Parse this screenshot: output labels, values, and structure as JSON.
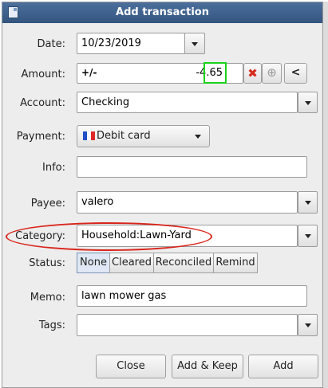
{
  "title": "Add transaction",
  "labels": {
    "date": "Date:",
    "amount": "Amount:",
    "account": "Account:",
    "payment": "Payment:",
    "info": "Info:",
    "payee": "Payee:",
    "category": "Category:",
    "status": "Status:",
    "memo": "Memo:",
    "tags": "Tags:"
  },
  "date": {
    "value": "10/23/2019"
  },
  "amount": {
    "sign_toggle": "+/-",
    "value": "-4.65"
  },
  "account": {
    "value": "Checking"
  },
  "payment": {
    "value": "Debit card"
  },
  "info": {
    "value": ""
  },
  "payee": {
    "value": "valero"
  },
  "category": {
    "value": "Household:Lawn-Yard"
  },
  "status": {
    "options": [
      "None",
      "Cleared",
      "Reconciled",
      "Remind"
    ],
    "selected": "None"
  },
  "memo": {
    "value": "lawn mower gas"
  },
  "tags": {
    "value": ""
  },
  "buttons": {
    "close": "Close",
    "add_keep": "Add & Keep",
    "add": "Add"
  },
  "colors": {
    "titlebar": "#3d5f8a",
    "highlight": "#d9251c",
    "focus": "#1cd11c",
    "clear_icon": "#d62c1e"
  }
}
